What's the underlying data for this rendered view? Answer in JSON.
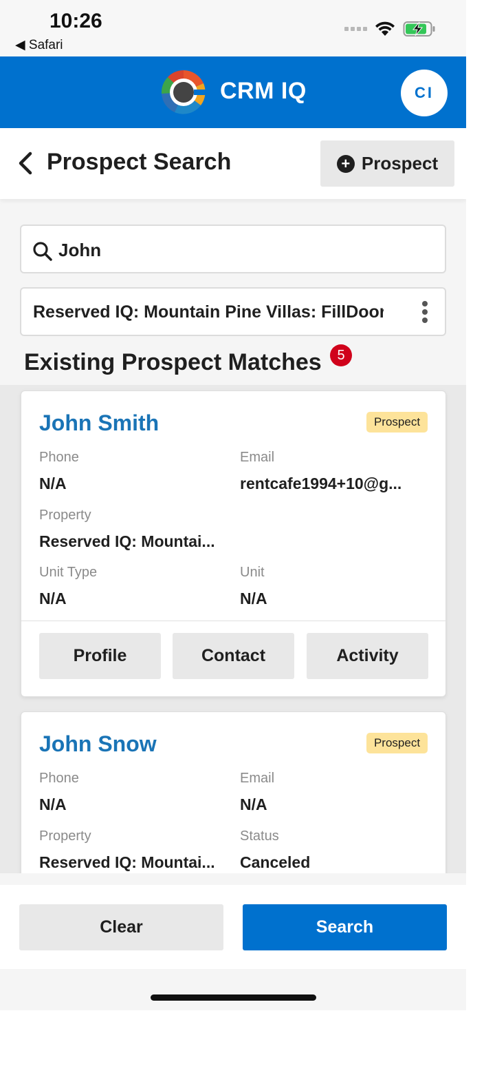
{
  "status_bar": {
    "time": "10:26",
    "back_app": "◀ Safari"
  },
  "header": {
    "app_name": "CRM IQ",
    "user_initials": "CI",
    "brand_color": "#0071ce"
  },
  "title_bar": {
    "title": "Prospect Search",
    "add_label": "Prospect"
  },
  "search": {
    "query": "John",
    "filter": "Reserved IQ: Mountain Pine Villas: FillDoor"
  },
  "matches": {
    "title": "Existing Prospect Matches",
    "count": "5",
    "cards": [
      {
        "name": "John Smith",
        "badge": "Prospect",
        "phone_label": "Phone",
        "phone": "N/A",
        "email_label": "Email",
        "email": "rentcafe1994+10@g...",
        "property_label": "Property",
        "property": "Reserved IQ: Mountai...",
        "unit_type_label": "Unit Type",
        "unit_type": "N/A",
        "unit_label": "Unit",
        "unit": "N/A",
        "buttons": [
          "Profile",
          "Contact",
          "Activity"
        ]
      },
      {
        "name": "John Snow",
        "badge": "Prospect",
        "phone_label": "Phone",
        "phone": "N/A",
        "email_label": "Email",
        "email": "N/A",
        "property_label": "Property",
        "property": "Reserved IQ: Mountai...",
        "status_label": "Status",
        "status": "Canceled"
      }
    ]
  },
  "actions": {
    "clear": "Clear",
    "search": "Search"
  }
}
